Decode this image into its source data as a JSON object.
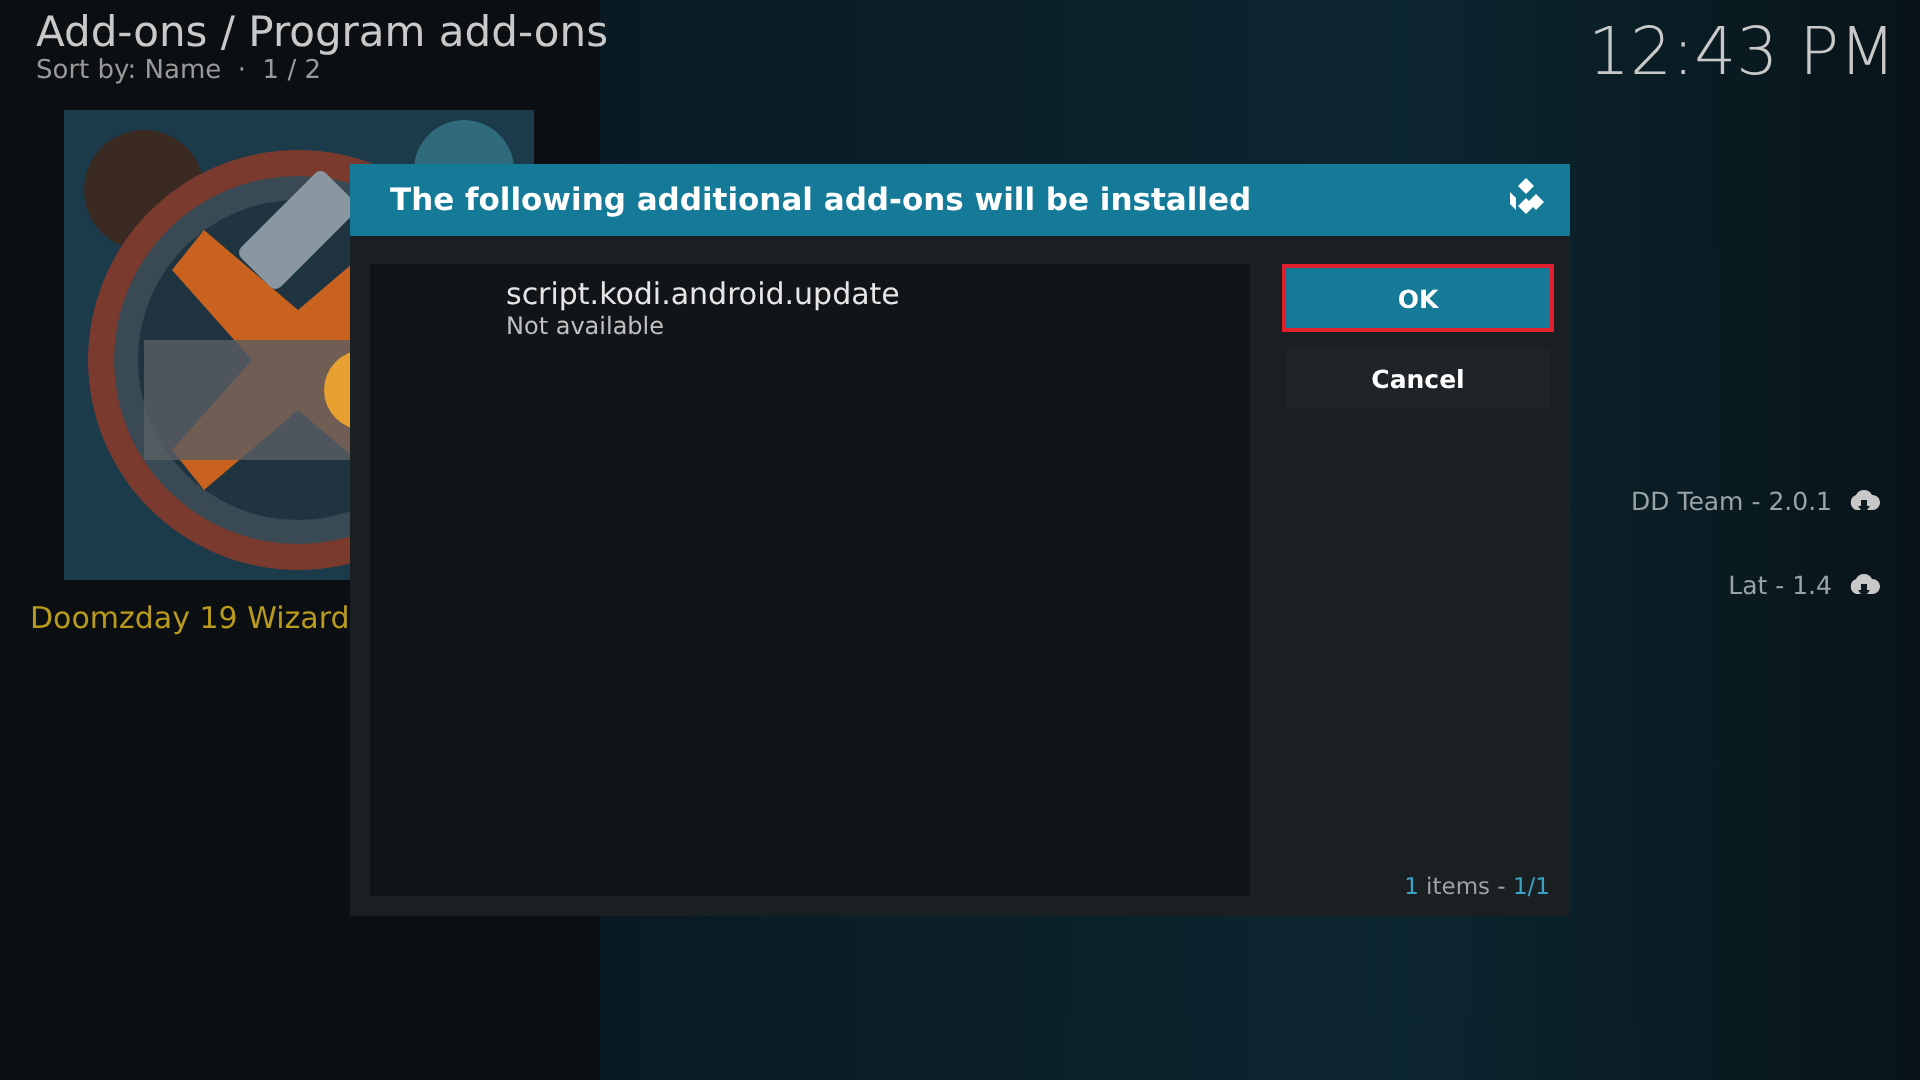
{
  "header": {
    "title": "Add-ons / Program add-ons",
    "subtitle": "Sort by: Name  ·  1 / 2",
    "clock": "12:43 PM"
  },
  "addon": {
    "name": "Doomzday 19 Wizard"
  },
  "side_items": [
    {
      "label": "DD Team - 2.0.1"
    },
    {
      "label": "Lat - 1.4"
    }
  ],
  "dialog": {
    "title": "The following additional add-ons will be installed",
    "items": [
      {
        "name": "script.kodi.android.update",
        "status": "Not available"
      }
    ],
    "buttons": [
      {
        "label": "OK",
        "selected": true
      },
      {
        "label": "Cancel",
        "selected": false
      }
    ],
    "footer": {
      "count": "1",
      "label": "items -",
      "page": "1/1"
    }
  }
}
